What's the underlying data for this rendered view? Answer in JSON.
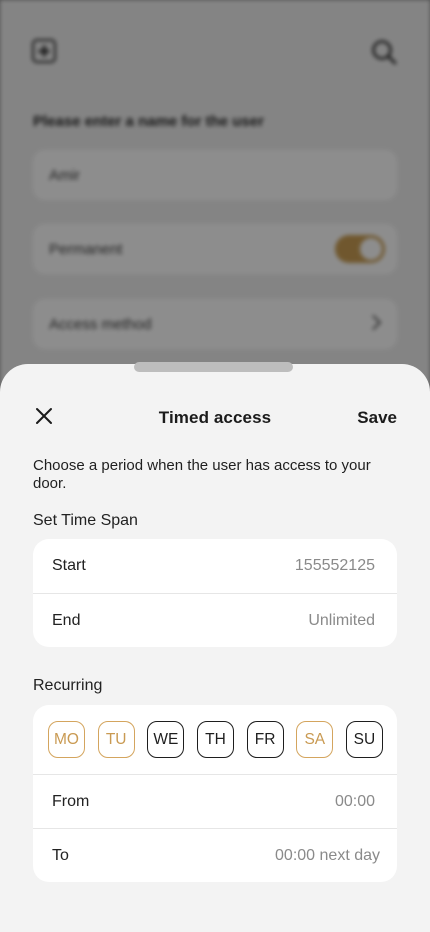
{
  "background": {
    "heading": "Please enter a name for the user",
    "name_value": "Amir",
    "permanent_label": "Permanent",
    "permanent_on": true,
    "access_method_label": "Access method"
  },
  "sheet": {
    "title": "Timed access",
    "save_label": "Save",
    "description": "Choose a period when the user has access to your door.",
    "time_span_label": "Set Time Span",
    "time_span": {
      "start_label": "Start",
      "start_value": "155552125",
      "end_label": "End",
      "end_value": "Unlimited"
    },
    "recurring_label": "Recurring",
    "days": [
      {
        "label": "MO",
        "active": true
      },
      {
        "label": "TU",
        "active": true
      },
      {
        "label": "WE",
        "active": false
      },
      {
        "label": "TH",
        "active": false
      },
      {
        "label": "FR",
        "active": false
      },
      {
        "label": "SA",
        "active": true
      },
      {
        "label": "SU",
        "active": false
      }
    ],
    "from_label": "From",
    "from_value": "00:00",
    "to_label": "To",
    "to_value": "00:00 next day"
  },
  "colors": {
    "accent": "#c99a52",
    "sheet_bg": "#f3f3f3",
    "card_bg": "#ffffff",
    "muted_text": "#8a8a8a"
  },
  "icons": {
    "close": "close-icon",
    "add": "add-square-icon",
    "search": "search-icon",
    "chevron": "chevron-right-icon"
  }
}
